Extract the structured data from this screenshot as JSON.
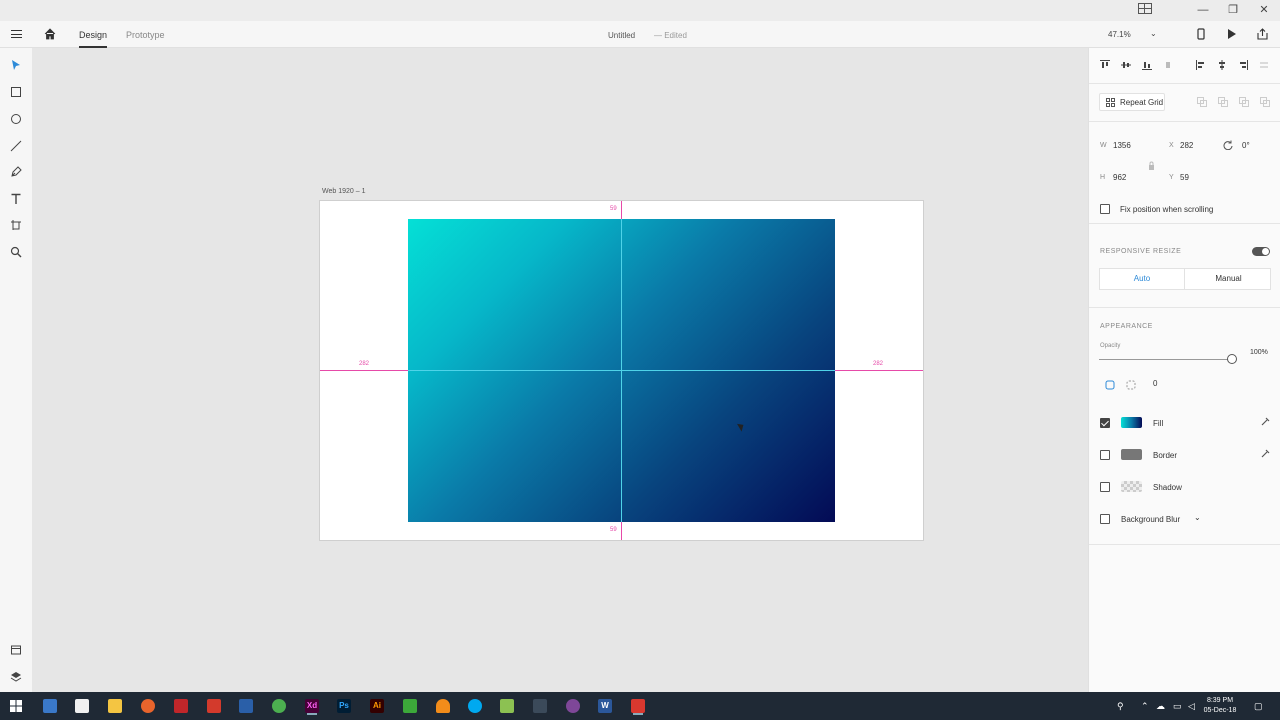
{
  "titlebar": {
    "layout_icon": "panel-layout-icon",
    "minimize": "—",
    "restore": "❐",
    "close": "✕"
  },
  "toolbar": {
    "menu_icon": "hamburger-icon",
    "home_icon": "home-icon",
    "tabs": [
      {
        "label": "Design",
        "active": true
      },
      {
        "label": "Prototype",
        "active": false
      }
    ],
    "document_title": "Untitled",
    "document_status": "— Edited",
    "zoom": "47.1%",
    "zoom_caret": "⌄",
    "device_preview_icon": "mobile-icon",
    "play_icon": "play-icon",
    "share_icon": "share-icon"
  },
  "left_tools": [
    "select-icon",
    "rectangle-icon",
    "ellipse-icon",
    "line-icon",
    "pen-icon",
    "text-icon",
    "artboard-icon",
    "zoom-icon",
    "assets-icon",
    "layers-icon"
  ],
  "canvas": {
    "artboard_name": "Web 1920 – 1",
    "dist_top": "59",
    "dist_bottom": "59",
    "dist_left": "282",
    "dist_right": "282",
    "fill_gradient": [
      "#05e0d6",
      "#0a7aa8",
      "#030a55"
    ]
  },
  "panel": {
    "repeat_grid_label": "Repeat Grid",
    "w_label": "W",
    "w_value": "1356",
    "x_label": "X",
    "x_value": "282",
    "h_label": "H",
    "h_value": "962",
    "y_label": "Y",
    "y_value": "59",
    "rotation": "0°",
    "fix_position_label": "Fix position when scrolling",
    "responsive_resize_label": "RESPONSIVE RESIZE",
    "responsive_auto": "Auto",
    "responsive_manual": "Manual",
    "appearance_label": "APPEARANCE",
    "opacity_label": "Opacity",
    "opacity_value": "100%",
    "opacity_level": 1.0,
    "corner_radius": "0",
    "fill_label": "Fill",
    "fill_checked": true,
    "border_label": "Border",
    "border_checked": false,
    "border_color": "#777777",
    "shadow_label": "Shadow",
    "shadow_checked": false,
    "background_blur_label": "Background Blur",
    "background_blur_checked": false,
    "background_blur_caret": "⌄"
  },
  "taskbar": {
    "time": "8:39 PM",
    "date": "05-Dec-18",
    "apps": [
      "windows-start-icon",
      "task-view-icon",
      "paint-icon",
      "file-explorer-icon",
      "firefox-icon",
      "filezilla-icon",
      "app-c-red-icon",
      "notepad-icon",
      "chrome-icon",
      "xd-icon",
      "photoshop-icon",
      "illustrator-icon",
      "camtasia-icon",
      "vlc-icon",
      "skype-icon",
      "notepadpp-icon",
      "inkscape-icon",
      "tor-icon",
      "word-icon",
      "recorder-icon"
    ],
    "app_labels": {
      "xd": "Xd",
      "ps": "Ps",
      "ai": "Ai",
      "w": "W"
    }
  }
}
